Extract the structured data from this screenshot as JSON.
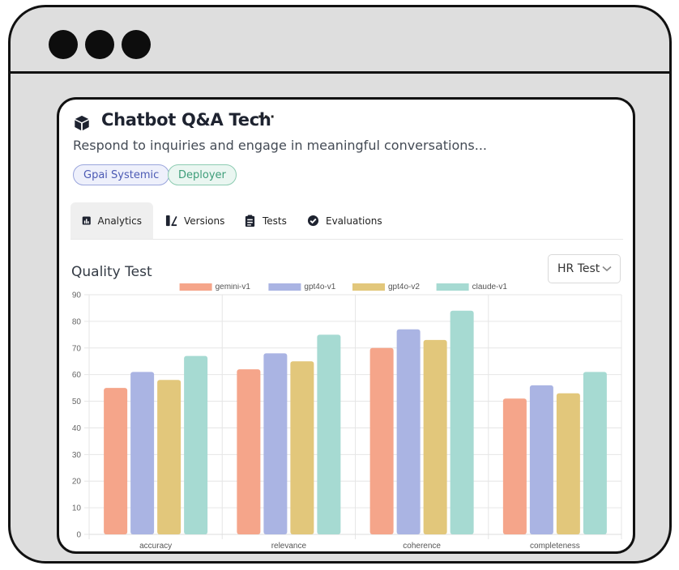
{
  "window": {
    "frame_color": "#111111",
    "background": "#dedede"
  },
  "app": {
    "icon": "package-icon",
    "title": "Chatbot Q&A Tech",
    "more": "···",
    "subtitle": "Respond to inquiries and engage in meaningful conversations...",
    "chips": [
      "Gpai Systemic",
      "Deployer"
    ]
  },
  "tabs": [
    {
      "label": "Analytics",
      "icon": "bar-chart-icon",
      "active": true
    },
    {
      "label": "Versions",
      "icon": "versions-icon",
      "active": false
    },
    {
      "label": "Tests",
      "icon": "clipboard-icon",
      "active": false
    },
    {
      "label": "Evaluations",
      "icon": "check-badge-icon",
      "active": false
    }
  ],
  "section": {
    "title": "Quality Test",
    "select_value": "HR Test"
  },
  "chart_data": {
    "type": "bar",
    "categories": [
      "accuracy",
      "relevance",
      "coherence",
      "completeness"
    ],
    "series": [
      {
        "name": "gemini-v1",
        "color": "#f5a58a",
        "values": [
          55,
          62,
          70,
          51
        ]
      },
      {
        "name": "gpt4o-v1",
        "color": "#aab4e3",
        "values": [
          61,
          68,
          77,
          56
        ]
      },
      {
        "name": "gpt4o-v2",
        "color": "#e2c77b",
        "values": [
          58,
          65,
          73,
          53
        ]
      },
      {
        "name": "claude-v1",
        "color": "#a6dad2",
        "values": [
          67,
          75,
          84,
          61
        ]
      }
    ],
    "ylim": [
      0,
      90
    ],
    "yticks": [
      0,
      10,
      20,
      30,
      40,
      50,
      60,
      70,
      80,
      90
    ],
    "grid": true,
    "legend": "top-center"
  }
}
